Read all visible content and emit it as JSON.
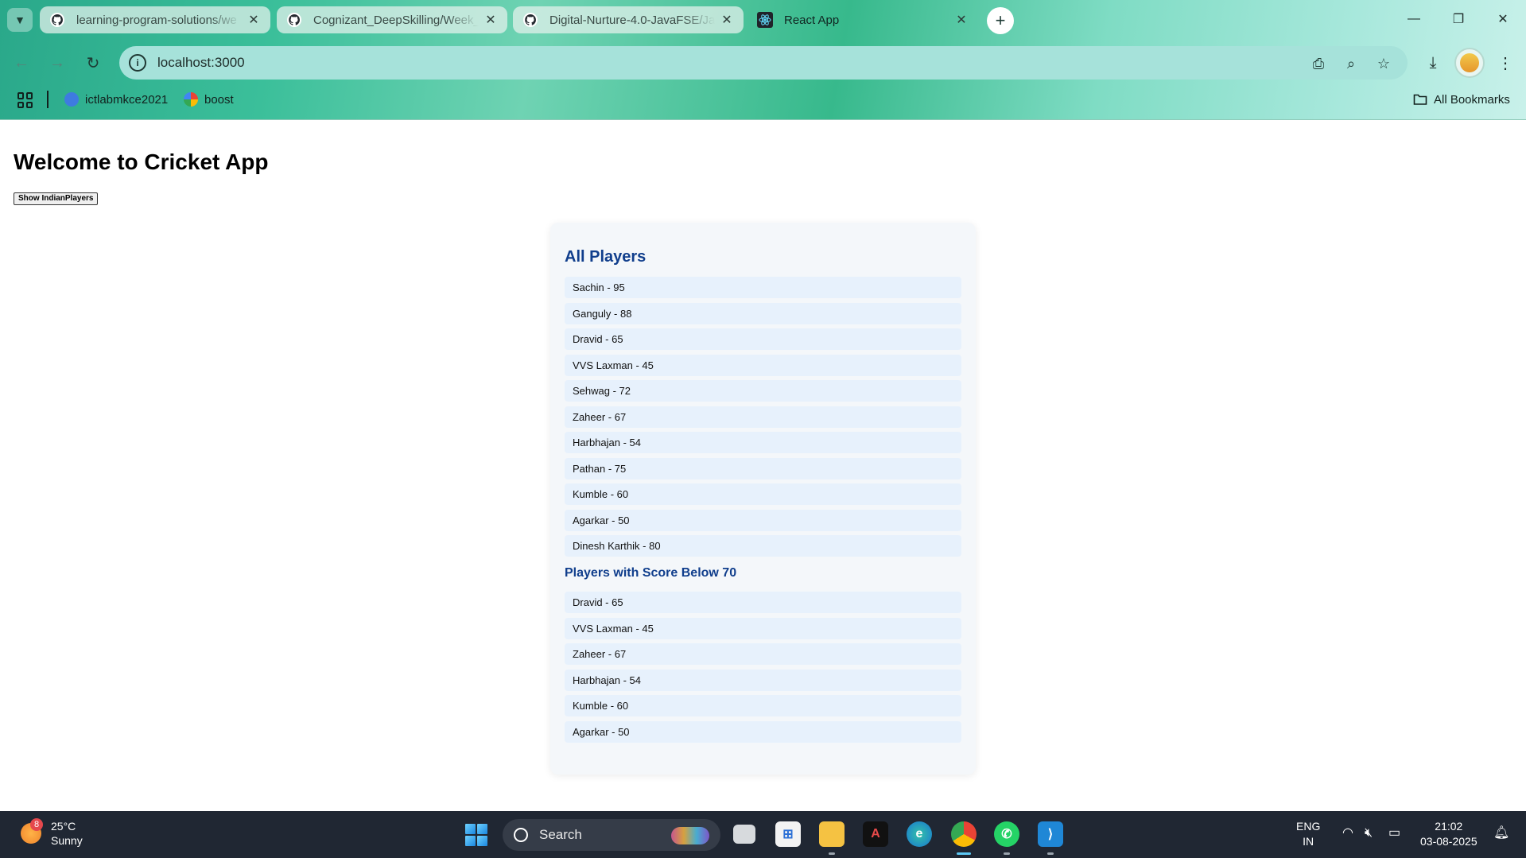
{
  "browser": {
    "tabs": [
      {
        "title": "learning-program-solutions/we",
        "icon": "github-icon",
        "active": false
      },
      {
        "title": "Cognizant_DeepSkilling/Week_",
        "icon": "github-icon",
        "active": false
      },
      {
        "title": "Digital-Nurture-4.0-JavaFSE/Jav",
        "icon": "github-icon",
        "active": false
      },
      {
        "title": "React App",
        "icon": "react-icon",
        "active": true
      }
    ],
    "url": "localhost:3000",
    "bookmarks": [
      {
        "label": "ictlabmkce2021"
      },
      {
        "label": "boost"
      }
    ],
    "all_bookmarks_label": "All Bookmarks"
  },
  "page": {
    "heading": "Welcome to Cricket App",
    "toggle_button_label": "Show IndianPlayers",
    "all_players_title": "All Players",
    "all_players": [
      "Sachin - 95",
      "Ganguly - 88",
      "Dravid - 65",
      "VVS Laxman - 45",
      "Sehwag - 72",
      "Zaheer - 67",
      "Harbhajan - 54",
      "Pathan - 75",
      "Kumble - 60",
      "Agarkar - 50",
      "Dinesh Karthik - 80"
    ],
    "below70_title": "Players with Score Below 70",
    "below70_players": [
      "Dravid - 65",
      "VVS Laxman - 45",
      "Zaheer - 67",
      "Harbhajan - 54",
      "Kumble - 60",
      "Agarkar - 50"
    ]
  },
  "taskbar": {
    "weather_badge": "8",
    "temperature": "25°C",
    "condition": "Sunny",
    "search_label": "Search",
    "language_line1": "ENG",
    "language_line2": "IN",
    "time": "21:02",
    "date": "03-08-2025"
  },
  "colors": {
    "card_background": "#f4f7fa",
    "list_item_background": "#e7f1fc",
    "heading_blue": "#103e8c",
    "taskbar": "#202733"
  }
}
